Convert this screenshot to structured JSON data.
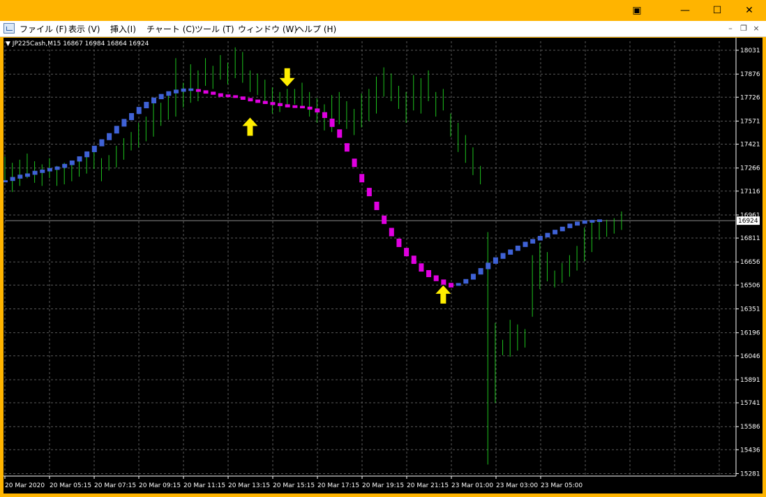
{
  "window": {
    "controls": {
      "extra": "▣",
      "minimize": "—",
      "maximize": "☐",
      "close": "✕"
    }
  },
  "menu": {
    "items": [
      "ファイル (F)",
      "表示 (V)",
      "挿入(I)",
      "チャート (C)",
      "ツール (T)",
      "ウィンドウ (W)",
      "ヘルプ (H)"
    ],
    "mdi": {
      "minimize": "–",
      "restore": "❐",
      "close": "×"
    }
  },
  "chart": {
    "symbol_line": "JP225Cash,M15  16867 16984 16864 16924",
    "current_price_label": "16924",
    "colors": {
      "background": "#000000",
      "grid": "#5a5a5a",
      "candles": "#1dc41d",
      "ma_up": "#3f62d6",
      "ma_down": "#e000e0",
      "arrows": "#ffee00",
      "axis_text": "#ffffff"
    }
  },
  "chart_data": {
    "type": "line",
    "y_ticks": [
      18031,
      17876,
      17726,
      17571,
      17421,
      17266,
      17116,
      16961,
      16811,
      16656,
      16506,
      16351,
      16196,
      16046,
      15891,
      15741,
      15586,
      15436,
      15281
    ],
    "x_ticks": [
      "20 Mar 2020",
      "20 Mar 05:15",
      "20 Mar 07:15",
      "20 Mar 09:15",
      "20 Mar 11:15",
      "20 Mar 13:15",
      "20 Mar 15:15",
      "20 Mar 17:15",
      "20 Mar 19:15",
      "20 Mar 21:15",
      "23 Mar 01:00",
      "23 Mar 03:00",
      "23 Mar 05:00"
    ],
    "ylim": [
      15265,
      18090
    ],
    "current_price": 16924,
    "bar_count": 84,
    "bars": [
      {
        "h": 17340,
        "l": 17180
      },
      {
        "h": 17300,
        "l": 17110
      },
      {
        "h": 17320,
        "l": 17150
      },
      {
        "h": 17360,
        "l": 17200
      },
      {
        "h": 17310,
        "l": 17170
      },
      {
        "h": 17290,
        "l": 17150
      },
      {
        "h": 17330,
        "l": 17200
      },
      {
        "h": 17280,
        "l": 17150
      },
      {
        "h": 17300,
        "l": 17160
      },
      {
        "h": 17290,
        "l": 17180
      },
      {
        "h": 17320,
        "l": 17210
      },
      {
        "h": 17350,
        "l": 17230
      },
      {
        "h": 17380,
        "l": 17260
      },
      {
        "h": 17330,
        "l": 17180
      },
      {
        "h": 17350,
        "l": 17250
      },
      {
        "h": 17410,
        "l": 17270
      },
      {
        "h": 17460,
        "l": 17320
      },
      {
        "h": 17500,
        "l": 17380
      },
      {
        "h": 17560,
        "l": 17400
      },
      {
        "h": 17600,
        "l": 17440
      },
      {
        "h": 17720,
        "l": 17470
      },
      {
        "h": 17690,
        "l": 17540
      },
      {
        "h": 17750,
        "l": 17580
      },
      {
        "h": 17980,
        "l": 17600
      },
      {
        "h": 17820,
        "l": 17660
      },
      {
        "h": 17940,
        "l": 17690
      },
      {
        "h": 17900,
        "l": 17700
      },
      {
        "h": 17980,
        "l": 17800
      },
      {
        "h": 17930,
        "l": 17780
      },
      {
        "h": 18000,
        "l": 17840
      },
      {
        "h": 17950,
        "l": 17810
      },
      {
        "h": 18050,
        "l": 17850
      },
      {
        "h": 18020,
        "l": 17820
      },
      {
        "h": 17900,
        "l": 17760
      },
      {
        "h": 17880,
        "l": 17740
      },
      {
        "h": 17840,
        "l": 17700
      },
      {
        "h": 17790,
        "l": 17620
      },
      {
        "h": 17760,
        "l": 17630
      },
      {
        "h": 17780,
        "l": 17660
      },
      {
        "h": 17780,
        "l": 17680
      },
      {
        "h": 17820,
        "l": 17660
      },
      {
        "h": 17760,
        "l": 17600
      },
      {
        "h": 17720,
        "l": 17560
      },
      {
        "h": 17680,
        "l": 17510
      },
      {
        "h": 17740,
        "l": 17500
      },
      {
        "h": 17760,
        "l": 17550
      },
      {
        "h": 17700,
        "l": 17520
      },
      {
        "h": 17650,
        "l": 17480
      },
      {
        "h": 17750,
        "l": 17530
      },
      {
        "h": 17780,
        "l": 17570
      },
      {
        "h": 17860,
        "l": 17620
      },
      {
        "h": 17920,
        "l": 17730
      },
      {
        "h": 17880,
        "l": 17700
      },
      {
        "h": 17800,
        "l": 17650
      },
      {
        "h": 17760,
        "l": 17560
      },
      {
        "h": 17870,
        "l": 17640
      },
      {
        "h": 17850,
        "l": 17620
      },
      {
        "h": 17900,
        "l": 17700
      },
      {
        "h": 17760,
        "l": 17600
      },
      {
        "h": 17780,
        "l": 17640
      },
      {
        "h": 17620,
        "l": 17470
      },
      {
        "h": 17560,
        "l": 17370
      },
      {
        "h": 17480,
        "l": 17300
      },
      {
        "h": 17400,
        "l": 17220
      },
      {
        "h": 17280,
        "l": 17160
      },
      {
        "h": 16850,
        "l": 15340
      },
      {
        "h": 16260,
        "l": 15740
      },
      {
        "h": 16150,
        "l": 16050
      },
      {
        "h": 16280,
        "l": 16040
      },
      {
        "h": 16250,
        "l": 16080
      },
      {
        "h": 16220,
        "l": 16100
      },
      {
        "h": 16700,
        "l": 16300
      },
      {
        "h": 16780,
        "l": 16480
      },
      {
        "h": 16720,
        "l": 16530
      },
      {
        "h": 16600,
        "l": 16490
      },
      {
        "h": 16650,
        "l": 16520
      },
      {
        "h": 16700,
        "l": 16560
      },
      {
        "h": 16760,
        "l": 16600
      },
      {
        "h": 16880,
        "l": 16660
      },
      {
        "h": 16930,
        "l": 16720
      },
      {
        "h": 16930,
        "l": 16800
      },
      {
        "h": 16930,
        "l": 16820
      },
      {
        "h": 16940,
        "l": 16840
      },
      {
        "h": 16984,
        "l": 16864
      }
    ],
    "series": [
      {
        "name": "",
        "values": [
          17180,
          17195,
          17210,
          17220,
          17235,
          17245,
          17255,
          17265,
          17280,
          17300,
          17325,
          17355,
          17390,
          17430,
          17470,
          17515,
          17560,
          17600,
          17640,
          17675,
          17705,
          17730,
          17750,
          17763,
          17772,
          17775,
          17770,
          17760,
          17752,
          17740,
          17735,
          17730,
          17720,
          17710,
          17700,
          17692,
          17685,
          17678,
          17670,
          17665,
          17662,
          17655,
          17640,
          17610,
          17560,
          17490,
          17400,
          17300,
          17200,
          17110,
          17020,
          16930,
          16850,
          16780,
          16720,
          16670,
          16620,
          16580,
          16550,
          16525,
          16505,
          16510,
          16530,
          16560,
          16595,
          16630,
          16665,
          16695,
          16720,
          16745,
          16770,
          16790,
          16810,
          16830,
          16850,
          16870,
          16890,
          16905,
          16915,
          16920,
          16924
        ],
        "direction": [
          "up",
          "up",
          "up",
          "up",
          "up",
          "up",
          "up",
          "up",
          "up",
          "up",
          "up",
          "up",
          "up",
          "up",
          "up",
          "up",
          "up",
          "up",
          "up",
          "up",
          "up",
          "up",
          "up",
          "up",
          "up",
          "up",
          "dn",
          "dn",
          "dn",
          "dn",
          "dn",
          "dn",
          "dn",
          "dn",
          "dn",
          "dn",
          "dn",
          "dn",
          "dn",
          "dn",
          "dn",
          "dn",
          "dn",
          "dn",
          "dn",
          "dn",
          "dn",
          "dn",
          "dn",
          "dn",
          "dn",
          "dn",
          "dn",
          "dn",
          "dn",
          "dn",
          "dn",
          "dn",
          "dn",
          "dn",
          "dn",
          "up",
          "up",
          "up",
          "up",
          "up",
          "up",
          "up",
          "up",
          "up",
          "up",
          "up",
          "up",
          "up",
          "up",
          "up",
          "up",
          "up",
          "up",
          "up",
          "up"
        ]
      }
    ],
    "arrows": [
      {
        "type": "up",
        "bar": 33,
        "value": 17530
      },
      {
        "type": "down",
        "bar": 38,
        "value": 17860
      },
      {
        "type": "up",
        "bar": 59,
        "value": 16440
      }
    ]
  }
}
